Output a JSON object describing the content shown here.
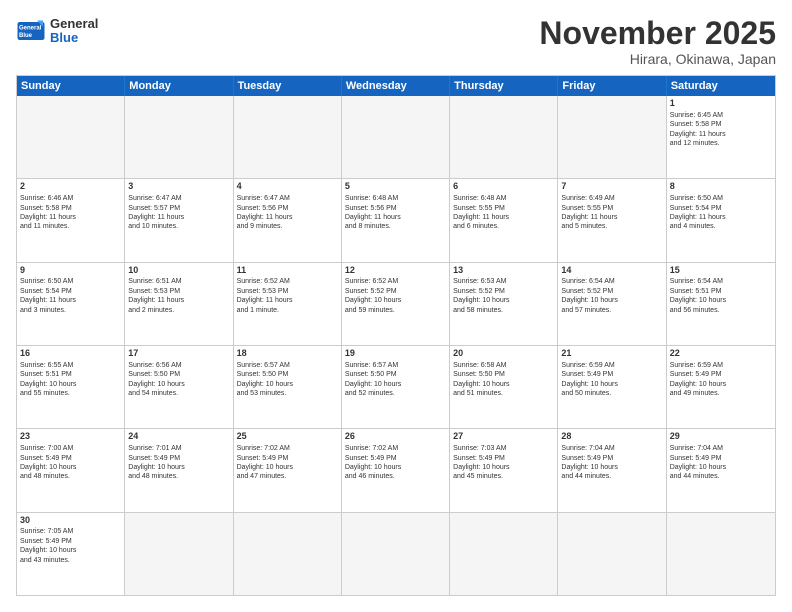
{
  "header": {
    "logo_general": "General",
    "logo_blue": "Blue",
    "month_title": "November 2025",
    "subtitle": "Hirara, Okinawa, Japan"
  },
  "days_of_week": [
    "Sunday",
    "Monday",
    "Tuesday",
    "Wednesday",
    "Thursday",
    "Friday",
    "Saturday"
  ],
  "weeks": [
    [
      {
        "day": "",
        "info": ""
      },
      {
        "day": "",
        "info": ""
      },
      {
        "day": "",
        "info": ""
      },
      {
        "day": "",
        "info": ""
      },
      {
        "day": "",
        "info": ""
      },
      {
        "day": "",
        "info": ""
      },
      {
        "day": "1",
        "info": "Sunrise: 6:45 AM\nSunset: 5:58 PM\nDaylight: 11 hours\nand 12 minutes."
      }
    ],
    [
      {
        "day": "2",
        "info": "Sunrise: 6:46 AM\nSunset: 5:58 PM\nDaylight: 11 hours\nand 11 minutes."
      },
      {
        "day": "3",
        "info": "Sunrise: 6:47 AM\nSunset: 5:57 PM\nDaylight: 11 hours\nand 10 minutes."
      },
      {
        "day": "4",
        "info": "Sunrise: 6:47 AM\nSunset: 5:56 PM\nDaylight: 11 hours\nand 9 minutes."
      },
      {
        "day": "5",
        "info": "Sunrise: 6:48 AM\nSunset: 5:56 PM\nDaylight: 11 hours\nand 8 minutes."
      },
      {
        "day": "6",
        "info": "Sunrise: 6:48 AM\nSunset: 5:55 PM\nDaylight: 11 hours\nand 6 minutes."
      },
      {
        "day": "7",
        "info": "Sunrise: 6:49 AM\nSunset: 5:55 PM\nDaylight: 11 hours\nand 5 minutes."
      },
      {
        "day": "8",
        "info": "Sunrise: 6:50 AM\nSunset: 5:54 PM\nDaylight: 11 hours\nand 4 minutes."
      }
    ],
    [
      {
        "day": "9",
        "info": "Sunrise: 6:50 AM\nSunset: 5:54 PM\nDaylight: 11 hours\nand 3 minutes."
      },
      {
        "day": "10",
        "info": "Sunrise: 6:51 AM\nSunset: 5:53 PM\nDaylight: 11 hours\nand 2 minutes."
      },
      {
        "day": "11",
        "info": "Sunrise: 6:52 AM\nSunset: 5:53 PM\nDaylight: 11 hours\nand 1 minute."
      },
      {
        "day": "12",
        "info": "Sunrise: 6:52 AM\nSunset: 5:52 PM\nDaylight: 10 hours\nand 59 minutes."
      },
      {
        "day": "13",
        "info": "Sunrise: 6:53 AM\nSunset: 5:52 PM\nDaylight: 10 hours\nand 58 minutes."
      },
      {
        "day": "14",
        "info": "Sunrise: 6:54 AM\nSunset: 5:52 PM\nDaylight: 10 hours\nand 57 minutes."
      },
      {
        "day": "15",
        "info": "Sunrise: 6:54 AM\nSunset: 5:51 PM\nDaylight: 10 hours\nand 56 minutes."
      }
    ],
    [
      {
        "day": "16",
        "info": "Sunrise: 6:55 AM\nSunset: 5:51 PM\nDaylight: 10 hours\nand 55 minutes."
      },
      {
        "day": "17",
        "info": "Sunrise: 6:56 AM\nSunset: 5:50 PM\nDaylight: 10 hours\nand 54 minutes."
      },
      {
        "day": "18",
        "info": "Sunrise: 6:57 AM\nSunset: 5:50 PM\nDaylight: 10 hours\nand 53 minutes."
      },
      {
        "day": "19",
        "info": "Sunrise: 6:57 AM\nSunset: 5:50 PM\nDaylight: 10 hours\nand 52 minutes."
      },
      {
        "day": "20",
        "info": "Sunrise: 6:58 AM\nSunset: 5:50 PM\nDaylight: 10 hours\nand 51 minutes."
      },
      {
        "day": "21",
        "info": "Sunrise: 6:59 AM\nSunset: 5:49 PM\nDaylight: 10 hours\nand 50 minutes."
      },
      {
        "day": "22",
        "info": "Sunrise: 6:59 AM\nSunset: 5:49 PM\nDaylight: 10 hours\nand 49 minutes."
      }
    ],
    [
      {
        "day": "23",
        "info": "Sunrise: 7:00 AM\nSunset: 5:49 PM\nDaylight: 10 hours\nand 48 minutes."
      },
      {
        "day": "24",
        "info": "Sunrise: 7:01 AM\nSunset: 5:49 PM\nDaylight: 10 hours\nand 48 minutes."
      },
      {
        "day": "25",
        "info": "Sunrise: 7:02 AM\nSunset: 5:49 PM\nDaylight: 10 hours\nand 47 minutes."
      },
      {
        "day": "26",
        "info": "Sunrise: 7:02 AM\nSunset: 5:49 PM\nDaylight: 10 hours\nand 46 minutes."
      },
      {
        "day": "27",
        "info": "Sunrise: 7:03 AM\nSunset: 5:49 PM\nDaylight: 10 hours\nand 45 minutes."
      },
      {
        "day": "28",
        "info": "Sunrise: 7:04 AM\nSunset: 5:49 PM\nDaylight: 10 hours\nand 44 minutes."
      },
      {
        "day": "29",
        "info": "Sunrise: 7:04 AM\nSunset: 5:49 PM\nDaylight: 10 hours\nand 44 minutes."
      }
    ],
    [
      {
        "day": "30",
        "info": "Sunrise: 7:05 AM\nSunset: 5:49 PM\nDaylight: 10 hours\nand 43 minutes."
      },
      {
        "day": "",
        "info": ""
      },
      {
        "day": "",
        "info": ""
      },
      {
        "day": "",
        "info": ""
      },
      {
        "day": "",
        "info": ""
      },
      {
        "day": "",
        "info": ""
      },
      {
        "day": "",
        "info": ""
      }
    ]
  ]
}
